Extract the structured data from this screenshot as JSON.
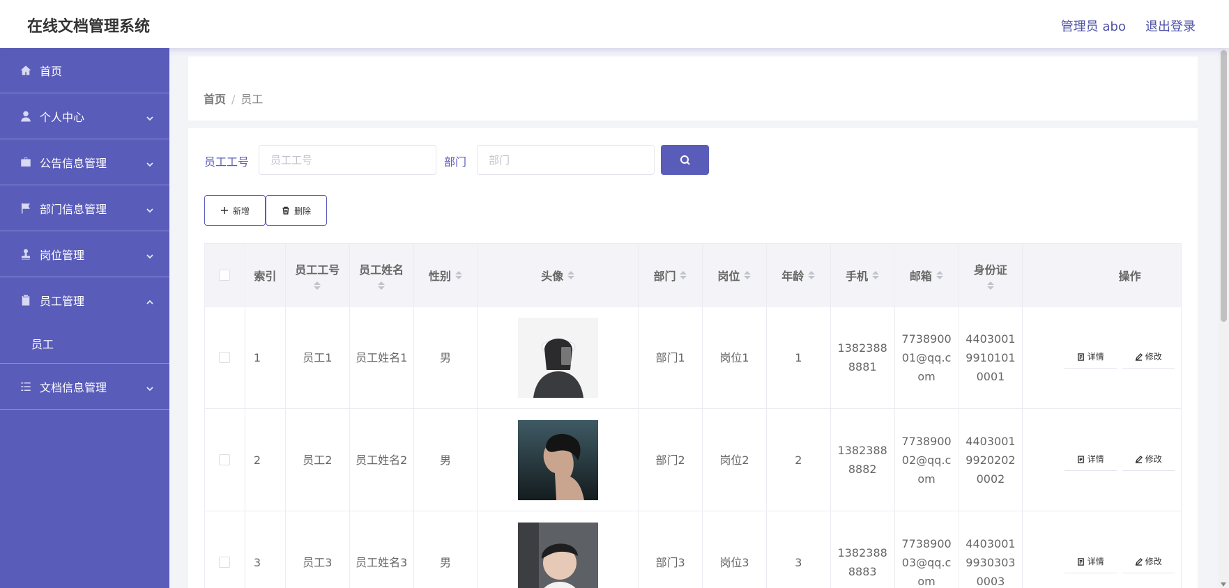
{
  "header": {
    "title": "在线文档管理系统",
    "user": "管理员 abo",
    "logout": "退出登录"
  },
  "sidebar": {
    "items": [
      {
        "label": "首页",
        "icon": "home-icon"
      },
      {
        "label": "个人中心",
        "icon": "user-icon"
      },
      {
        "label": "公告信息管理",
        "icon": "briefcase-icon"
      },
      {
        "label": "部门信息管理",
        "icon": "flag-icon"
      },
      {
        "label": "岗位管理",
        "icon": "stamp-icon"
      },
      {
        "label": "员工管理",
        "icon": "clipboard-icon"
      },
      {
        "label": "员工",
        "icon": ""
      },
      {
        "label": "文档信息管理",
        "icon": "list-icon"
      }
    ]
  },
  "breadcrumb": {
    "home": "首页",
    "separator": "/",
    "current": "员工"
  },
  "search": {
    "emp_no_label": "员工工号",
    "emp_no_placeholder": "员工工号",
    "dept_label": "部门",
    "dept_placeholder": "部门"
  },
  "actions": {
    "add": "新增",
    "delete": "删除"
  },
  "table": {
    "headers": [
      "索引",
      "员工工号",
      "员工姓名",
      "性别",
      "头像",
      "部门",
      "岗位",
      "年龄",
      "手机",
      "邮箱",
      "身份证",
      "操作"
    ],
    "rows": [
      {
        "index": "1",
        "emp_no": "员工1",
        "name": "员工姓名1",
        "gender": "男",
        "dept": "部门1",
        "post": "岗位1",
        "age": "1",
        "phone": "13823888881",
        "email": "773890001@qq.com",
        "id_card": "440300199101010001"
      },
      {
        "index": "2",
        "emp_no": "员工2",
        "name": "员工姓名2",
        "gender": "男",
        "dept": "部门2",
        "post": "岗位2",
        "age": "2",
        "phone": "13823888882",
        "email": "773890002@qq.com",
        "id_card": "440300199202020002"
      },
      {
        "index": "3",
        "emp_no": "员工3",
        "name": "员工姓名3",
        "gender": "男",
        "dept": "部门3",
        "post": "岗位3",
        "age": "3",
        "phone": "13823888883",
        "email": "773890003@qq.com",
        "id_card": "440300199303030003"
      }
    ],
    "op_detail": "详情",
    "op_edit": "修改"
  },
  "colors": {
    "primary": "#5a5cb9",
    "sidebar_divider": "#8e90d6"
  }
}
